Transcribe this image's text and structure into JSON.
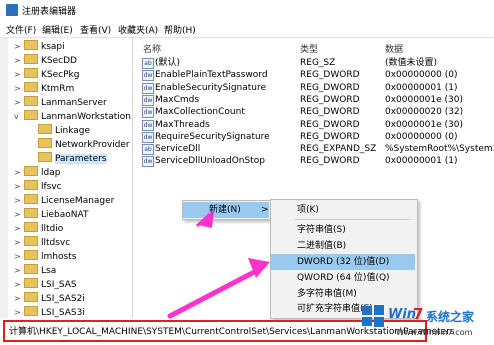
{
  "window": {
    "title": "注册表编辑器"
  },
  "menu": [
    "文件(F)",
    "编辑(E)",
    "查看(V)",
    "收藏夹(A)",
    "帮助(H)"
  ],
  "tree": {
    "items": [
      {
        "label": "ksapi",
        "expander": ">",
        "depth": 0
      },
      {
        "label": "KSecDD",
        "expander": ">",
        "depth": 0
      },
      {
        "label": "KSecPkg",
        "expander": ">",
        "depth": 0
      },
      {
        "label": "KtmRm",
        "expander": ">",
        "depth": 0
      },
      {
        "label": "LanmanServer",
        "expander": ">",
        "depth": 0
      },
      {
        "label": "LanmanWorkstation",
        "expander": "v",
        "depth": 0
      },
      {
        "label": "Linkage",
        "expander": "",
        "depth": 1
      },
      {
        "label": "NetworkProvider",
        "expander": "",
        "depth": 1
      },
      {
        "label": "Parameters",
        "expander": "",
        "depth": 1,
        "selected": true
      },
      {
        "label": "ldap",
        "expander": ">",
        "depth": 0
      },
      {
        "label": "lfsvc",
        "expander": ">",
        "depth": 0
      },
      {
        "label": "LicenseManager",
        "expander": ">",
        "depth": 0
      },
      {
        "label": "LiebaoNAT",
        "expander": ">",
        "depth": 0
      },
      {
        "label": "lltdio",
        "expander": ">",
        "depth": 0
      },
      {
        "label": "lltdsvc",
        "expander": ">",
        "depth": 0
      },
      {
        "label": "lmhosts",
        "expander": ">",
        "depth": 0
      },
      {
        "label": "Lsa",
        "expander": ">",
        "depth": 0
      },
      {
        "label": "LSI_SAS",
        "expander": ">",
        "depth": 0
      },
      {
        "label": "LSI_SAS2i",
        "expander": ">",
        "depth": 0
      },
      {
        "label": "LSI_SAS3i",
        "expander": ">",
        "depth": 0
      }
    ]
  },
  "list": {
    "headers": {
      "name": "名称",
      "type": "类型",
      "data": "数据"
    },
    "rows": [
      {
        "icon": "ab",
        "name": "(默认)",
        "type": "REG_SZ",
        "data": "(数值未设置)"
      },
      {
        "icon": "dw",
        "name": "EnablePlainTextPassword",
        "type": "REG_DWORD",
        "data": "0x00000000 (0)"
      },
      {
        "icon": "dw",
        "name": "EnableSecuritySignature",
        "type": "REG_DWORD",
        "data": "0x00000001 (1)"
      },
      {
        "icon": "dw",
        "name": "MaxCmds",
        "type": "REG_DWORD",
        "data": "0x0000001e (30)"
      },
      {
        "icon": "dw",
        "name": "MaxCollectionCount",
        "type": "REG_DWORD",
        "data": "0x00000020 (32)"
      },
      {
        "icon": "dw",
        "name": "MaxThreads",
        "type": "REG_DWORD",
        "data": "0x0000001e (30)"
      },
      {
        "icon": "dw",
        "name": "RequireSecuritySignature",
        "type": "REG_DWORD",
        "data": "0x00000000 (0)"
      },
      {
        "icon": "ab",
        "name": "ServiceDll",
        "type": "REG_EXPAND_SZ",
        "data": "%SystemRoot%\\System32\\"
      },
      {
        "icon": "dw",
        "name": "ServiceDllUnloadOnStop",
        "type": "REG_DWORD",
        "data": "0x00000001 (1)"
      }
    ]
  },
  "context_menu": {
    "new_label": "新建(N)",
    "arrow": ">"
  },
  "submenu": {
    "items": [
      {
        "label": "项(K)",
        "highlight": false
      },
      {
        "label": "字符串值(S)",
        "highlight": false
      },
      {
        "label": "二进制值(B)",
        "highlight": false
      },
      {
        "label": "DWORD (32 位)值(D)",
        "highlight": true
      },
      {
        "label": "QWORD (64 位)值(Q)",
        "highlight": false
      },
      {
        "label": "多字符串值(M)",
        "highlight": false
      },
      {
        "label": "可扩充字符串值(E)",
        "highlight": false
      }
    ]
  },
  "statusbar": {
    "path": "计算机\\HKEY_LOCAL_MACHINE\\SYSTEM\\CurrentControlSet\\Services\\LanmanWorkstation\\Parameters"
  },
  "watermark": {
    "brand_a": "Win",
    "brand_num": "7",
    "brand_b": "系统之家",
    "url": "Www.Winwin7.com"
  },
  "colors": {
    "highlight": "#99c9ef",
    "selection": "#cce8ff",
    "arrow": "#ff33cc",
    "status_border": "#e02020"
  }
}
